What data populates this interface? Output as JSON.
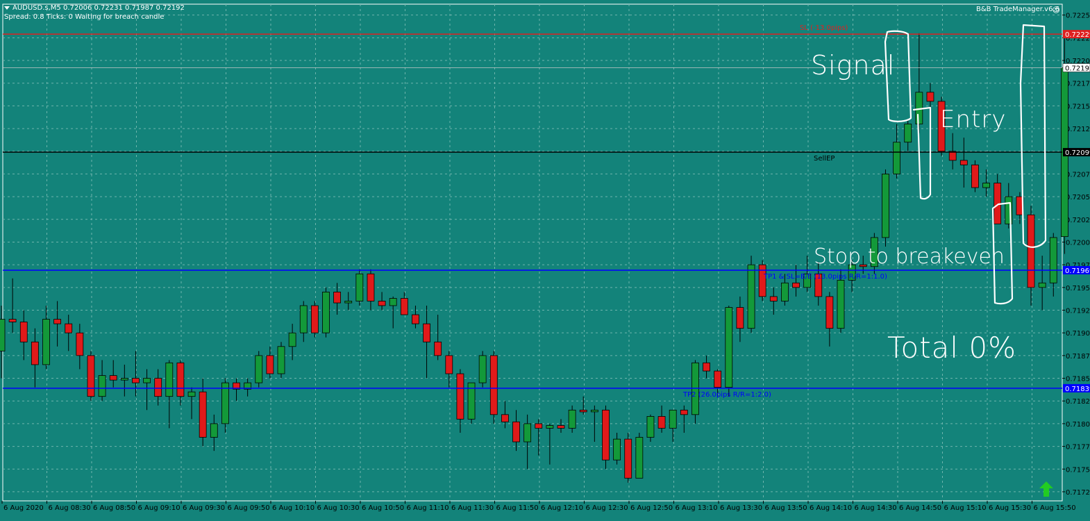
{
  "header": {
    "symbol_line": "AUDUSD.s,M5  0.72006 0.72231 0.71987 0.72192",
    "status_line": "Spread: 0.8   Ticks: 0   Waiting for breach candle",
    "brand": "B&B TradeManager.v6.6",
    "brand_icon": "smiley-icon"
  },
  "annotations": {
    "signal": "Signal",
    "entry": "Entry",
    "stop_breakeven": "Stop to breakeven",
    "total": "Total 0%"
  },
  "chart_data": {
    "type": "candlestick",
    "symbol": "AUDUSD.s",
    "timeframe": "M5",
    "ylim": [
      0.71715,
      0.72262
    ],
    "y_ticks": [
      "0.72250",
      "0.72225",
      "0.72200",
      "0.72175",
      "0.72150",
      "0.72125",
      "0.72100",
      "0.72075",
      "0.72050",
      "0.72025",
      "0.72000",
      "0.71975",
      "0.71950",
      "0.71925",
      "0.71900",
      "0.71875",
      "0.71850",
      "0.71825",
      "0.71800",
      "0.71775",
      "0.71750",
      "0.71725"
    ],
    "x_labels": [
      "6 Aug 2020",
      "6 Aug 08:30",
      "6 Aug 08:50",
      "6 Aug 09:10",
      "6 Aug 09:30",
      "6 Aug 09:50",
      "6 Aug 10:10",
      "6 Aug 10:30",
      "6 Aug 10:50",
      "6 Aug 11:10",
      "6 Aug 11:30",
      "6 Aug 11:50",
      "6 Aug 12:10",
      "6 Aug 12:30",
      "6 Aug 12:50",
      "6 Aug 13:10",
      "6 Aug 13:30",
      "6 Aug 13:50",
      "6 Aug 14:10",
      "6 Aug 14:30",
      "6 Aug 14:50",
      "6 Aug 15:10",
      "6 Aug 15:30",
      "6 Aug 15:50"
    ],
    "grid": true,
    "levels": [
      {
        "name": "sl",
        "price": 0.72229,
        "price_label": "0.72229",
        "text": "SL (-13.0pips)",
        "color": "#e02020",
        "text_color": "#e02020",
        "box_bg": "#e02020",
        "box_fg": "#ffffff"
      },
      {
        "name": "sell-ep",
        "price": 0.72099,
        "price_label": "0.72099",
        "text": "SellEP",
        "color": "#000000",
        "text_color": "#000000",
        "box_bg": "#000000",
        "box_fg": "#ffffff"
      },
      {
        "name": "tp1",
        "price": 0.71969,
        "price_label": "0.71969",
        "text": "TP1 & SL=B/E (13.0pips R/R=1:1.0)",
        "color": "#0000ff",
        "text_color": "#0000ff",
        "box_bg": "#0000ff",
        "box_fg": "#ffffff"
      },
      {
        "name": "tp2",
        "price": 0.71839,
        "price_label": "0.71839",
        "text": "TP2 (26.0pips R/R=1:2.0)",
        "color": "#0000ff",
        "text_color": "#0000ff",
        "box_bg": "#0000ff",
        "box_fg": "#ffffff"
      }
    ],
    "current_price": {
      "price": 0.72192,
      "label": "0.72192"
    },
    "colors": {
      "background": "#13837a",
      "bull": "#139939",
      "bear": "#e01a1a",
      "wick": "#000000",
      "grid": "#6fb5ad",
      "axis_text": "#000000"
    },
    "candles": [
      {
        "o": 0.7188,
        "h": 0.7193,
        "l": 0.7185,
        "c": 0.71915
      },
      {
        "o": 0.71915,
        "h": 0.7196,
        "l": 0.719,
        "c": 0.71912
      },
      {
        "o": 0.71912,
        "h": 0.71925,
        "l": 0.7187,
        "c": 0.7189
      },
      {
        "o": 0.7189,
        "h": 0.71905,
        "l": 0.7184,
        "c": 0.71865
      },
      {
        "o": 0.71865,
        "h": 0.7193,
        "l": 0.7186,
        "c": 0.71915
      },
      {
        "o": 0.71915,
        "h": 0.71935,
        "l": 0.71885,
        "c": 0.7191
      },
      {
        "o": 0.7191,
        "h": 0.7192,
        "l": 0.7188,
        "c": 0.719
      },
      {
        "o": 0.719,
        "h": 0.7191,
        "l": 0.7186,
        "c": 0.71875
      },
      {
        "o": 0.71875,
        "h": 0.7188,
        "l": 0.71825,
        "c": 0.7183
      },
      {
        "o": 0.7183,
        "h": 0.7187,
        "l": 0.71825,
        "c": 0.71853
      },
      {
        "o": 0.71853,
        "h": 0.7187,
        "l": 0.7184,
        "c": 0.71848
      },
      {
        "o": 0.71848,
        "h": 0.71865,
        "l": 0.7183,
        "c": 0.7185
      },
      {
        "o": 0.7185,
        "h": 0.7188,
        "l": 0.7183,
        "c": 0.71845
      },
      {
        "o": 0.71845,
        "h": 0.7186,
        "l": 0.71815,
        "c": 0.7185
      },
      {
        "o": 0.7185,
        "h": 0.7186,
        "l": 0.7182,
        "c": 0.7183
      },
      {
        "o": 0.7183,
        "h": 0.7187,
        "l": 0.71795,
        "c": 0.71867
      },
      {
        "o": 0.71867,
        "h": 0.7187,
        "l": 0.7182,
        "c": 0.7183
      },
      {
        "o": 0.7183,
        "h": 0.7184,
        "l": 0.71805,
        "c": 0.71835
      },
      {
        "o": 0.71835,
        "h": 0.7185,
        "l": 0.71775,
        "c": 0.71785
      },
      {
        "o": 0.71785,
        "h": 0.7181,
        "l": 0.7177,
        "c": 0.718
      },
      {
        "o": 0.718,
        "h": 0.7185,
        "l": 0.7179,
        "c": 0.71845
      },
      {
        "o": 0.71845,
        "h": 0.7185,
        "l": 0.71825,
        "c": 0.71838
      },
      {
        "o": 0.71838,
        "h": 0.7185,
        "l": 0.7183,
        "c": 0.71845
      },
      {
        "o": 0.71845,
        "h": 0.7188,
        "l": 0.7184,
        "c": 0.71875
      },
      {
        "o": 0.71875,
        "h": 0.71885,
        "l": 0.7185,
        "c": 0.71855
      },
      {
        "o": 0.71855,
        "h": 0.7189,
        "l": 0.7185,
        "c": 0.71885
      },
      {
        "o": 0.71885,
        "h": 0.7191,
        "l": 0.7187,
        "c": 0.719
      },
      {
        "o": 0.719,
        "h": 0.71935,
        "l": 0.7189,
        "c": 0.7193
      },
      {
        "o": 0.7193,
        "h": 0.71935,
        "l": 0.71895,
        "c": 0.719
      },
      {
        "o": 0.719,
        "h": 0.7195,
        "l": 0.71895,
        "c": 0.71945
      },
      {
        "o": 0.71945,
        "h": 0.71955,
        "l": 0.7192,
        "c": 0.71933
      },
      {
        "o": 0.71933,
        "h": 0.71945,
        "l": 0.71925,
        "c": 0.71935
      },
      {
        "o": 0.71935,
        "h": 0.7197,
        "l": 0.7193,
        "c": 0.71965
      },
      {
        "o": 0.71965,
        "h": 0.7197,
        "l": 0.71925,
        "c": 0.71935
      },
      {
        "o": 0.71935,
        "h": 0.71945,
        "l": 0.71925,
        "c": 0.7193
      },
      {
        "o": 0.7193,
        "h": 0.7194,
        "l": 0.71905,
        "c": 0.71938
      },
      {
        "o": 0.71938,
        "h": 0.71945,
        "l": 0.7192,
        "c": 0.7192
      },
      {
        "o": 0.7192,
        "h": 0.7193,
        "l": 0.71905,
        "c": 0.7191
      },
      {
        "o": 0.7191,
        "h": 0.7193,
        "l": 0.7185,
        "c": 0.7189
      },
      {
        "o": 0.7189,
        "h": 0.7192,
        "l": 0.7187,
        "c": 0.71875
      },
      {
        "o": 0.71875,
        "h": 0.7188,
        "l": 0.7184,
        "c": 0.71855
      },
      {
        "o": 0.71855,
        "h": 0.7186,
        "l": 0.7179,
        "c": 0.71805
      },
      {
        "o": 0.71805,
        "h": 0.71845,
        "l": 0.718,
        "c": 0.71845
      },
      {
        "o": 0.71845,
        "h": 0.7188,
        "l": 0.7184,
        "c": 0.71875
      },
      {
        "o": 0.71875,
        "h": 0.7188,
        "l": 0.718,
        "c": 0.7181
      },
      {
        "o": 0.7181,
        "h": 0.71825,
        "l": 0.71795,
        "c": 0.71802
      },
      {
        "o": 0.71802,
        "h": 0.71815,
        "l": 0.7177,
        "c": 0.7178
      },
      {
        "o": 0.7178,
        "h": 0.7181,
        "l": 0.7175,
        "c": 0.718
      },
      {
        "o": 0.718,
        "h": 0.71805,
        "l": 0.71765,
        "c": 0.71795
      },
      {
        "o": 0.71795,
        "h": 0.718,
        "l": 0.71755,
        "c": 0.71798
      },
      {
        "o": 0.71798,
        "h": 0.71805,
        "l": 0.7179,
        "c": 0.71795
      },
      {
        "o": 0.71795,
        "h": 0.7182,
        "l": 0.7179,
        "c": 0.71815
      },
      {
        "o": 0.71815,
        "h": 0.7183,
        "l": 0.7181,
        "c": 0.71813
      },
      {
        "o": 0.71813,
        "h": 0.7182,
        "l": 0.7178,
        "c": 0.71815
      },
      {
        "o": 0.71815,
        "h": 0.7182,
        "l": 0.7175,
        "c": 0.7176
      },
      {
        "o": 0.7176,
        "h": 0.7179,
        "l": 0.71755,
        "c": 0.71783
      },
      {
        "o": 0.71783,
        "h": 0.7179,
        "l": 0.71735,
        "c": 0.7174
      },
      {
        "o": 0.7174,
        "h": 0.7179,
        "l": 0.7174,
        "c": 0.71785
      },
      {
        "o": 0.71785,
        "h": 0.7181,
        "l": 0.7178,
        "c": 0.71808
      },
      {
        "o": 0.71808,
        "h": 0.7182,
        "l": 0.7179,
        "c": 0.71795
      },
      {
        "o": 0.71795,
        "h": 0.71815,
        "l": 0.7178,
        "c": 0.71815
      },
      {
        "o": 0.71815,
        "h": 0.7182,
        "l": 0.7179,
        "c": 0.7181
      },
      {
        "o": 0.7181,
        "h": 0.7187,
        "l": 0.718,
        "c": 0.71867
      },
      {
        "o": 0.71867,
        "h": 0.71875,
        "l": 0.7185,
        "c": 0.71858
      },
      {
        "o": 0.71858,
        "h": 0.7186,
        "l": 0.7183,
        "c": 0.7184
      },
      {
        "o": 0.7184,
        "h": 0.7193,
        "l": 0.7183,
        "c": 0.71928
      },
      {
        "o": 0.71928,
        "h": 0.7194,
        "l": 0.7189,
        "c": 0.71905
      },
      {
        "o": 0.71905,
        "h": 0.71985,
        "l": 0.719,
        "c": 0.71975
      },
      {
        "o": 0.71975,
        "h": 0.7198,
        "l": 0.71935,
        "c": 0.7194
      },
      {
        "o": 0.7194,
        "h": 0.7195,
        "l": 0.7192,
        "c": 0.71935
      },
      {
        "o": 0.71935,
        "h": 0.71965,
        "l": 0.7193,
        "c": 0.71955
      },
      {
        "o": 0.71955,
        "h": 0.71975,
        "l": 0.7194,
        "c": 0.7195
      },
      {
        "o": 0.7195,
        "h": 0.71985,
        "l": 0.71945,
        "c": 0.71965
      },
      {
        "o": 0.71965,
        "h": 0.71978,
        "l": 0.7193,
        "c": 0.7194
      },
      {
        "o": 0.7194,
        "h": 0.71945,
        "l": 0.71885,
        "c": 0.71905
      },
      {
        "o": 0.71905,
        "h": 0.7197,
        "l": 0.719,
        "c": 0.71958
      },
      {
        "o": 0.71958,
        "h": 0.7198,
        "l": 0.71945,
        "c": 0.71975
      },
      {
        "o": 0.71975,
        "h": 0.71985,
        "l": 0.71965,
        "c": 0.71973
      },
      {
        "o": 0.71973,
        "h": 0.7201,
        "l": 0.71965,
        "c": 0.72005
      },
      {
        "o": 0.72005,
        "h": 0.7208,
        "l": 0.71995,
        "c": 0.72075
      },
      {
        "o": 0.72075,
        "h": 0.7213,
        "l": 0.7207,
        "c": 0.7211
      },
      {
        "o": 0.7211,
        "h": 0.72135,
        "l": 0.721,
        "c": 0.7213
      },
      {
        "o": 0.7213,
        "h": 0.7223,
        "l": 0.7212,
        "c": 0.72165
      },
      {
        "o": 0.72165,
        "h": 0.72175,
        "l": 0.7213,
        "c": 0.72155
      },
      {
        "o": 0.72155,
        "h": 0.7216,
        "l": 0.72095,
        "c": 0.721
      },
      {
        "o": 0.721,
        "h": 0.7212,
        "l": 0.7208,
        "c": 0.7209
      },
      {
        "o": 0.7209,
        "h": 0.72115,
        "l": 0.7206,
        "c": 0.72085
      },
      {
        "o": 0.72085,
        "h": 0.7209,
        "l": 0.72055,
        "c": 0.7206
      },
      {
        "o": 0.7206,
        "h": 0.7208,
        "l": 0.7205,
        "c": 0.72065
      },
      {
        "o": 0.72065,
        "h": 0.72075,
        "l": 0.7202,
        "c": 0.7202
      },
      {
        "o": 0.7202,
        "h": 0.72065,
        "l": 0.72015,
        "c": 0.7205
      },
      {
        "o": 0.7205,
        "h": 0.72055,
        "l": 0.7202,
        "c": 0.7203
      },
      {
        "o": 0.7203,
        "h": 0.7204,
        "l": 0.7193,
        "c": 0.7195
      },
      {
        "o": 0.7195,
        "h": 0.71985,
        "l": 0.71925,
        "c": 0.71955
      },
      {
        "o": 0.71955,
        "h": 0.7201,
        "l": 0.7194,
        "c": 0.72005
      },
      {
        "o": 0.72006,
        "h": 0.72231,
        "l": 0.71987,
        "c": 0.72192
      }
    ]
  }
}
